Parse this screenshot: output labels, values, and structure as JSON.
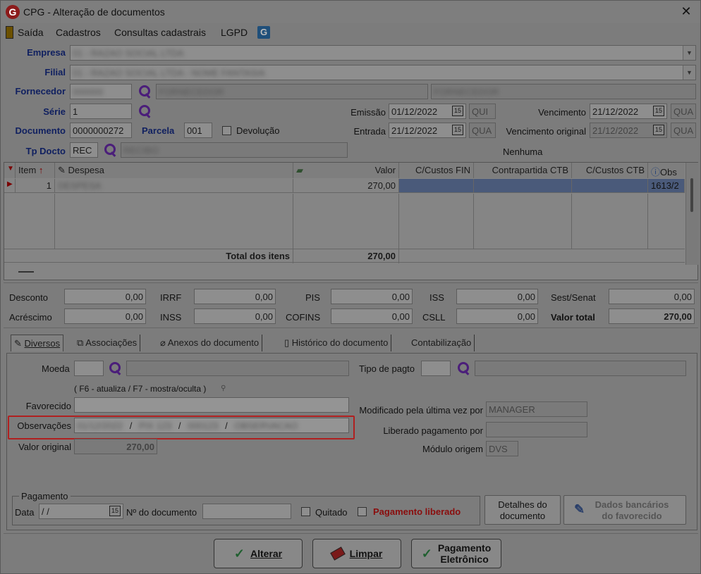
{
  "window": {
    "title": "CPG - Alteração de documentos",
    "logo_letter": "G",
    "close": "✕"
  },
  "menu": {
    "items": [
      "Saída",
      "Cadastros",
      "Consultas cadastrais",
      "LGPD"
    ]
  },
  "header": {
    "empresa_label": "Empresa",
    "empresa_value": "01 - RAZAO SOCIAL LTDA",
    "filial_label": "Filial",
    "filial_value": "01 - RAZAO SOCIAL LTDA - NOME FANTASIA",
    "fornecedor_label": "Fornecedor",
    "fornecedor_code": "000000",
    "fornecedor_name": "FORNECEDOR",
    "fornecedor_extra": "FORNECEDOR",
    "serie_label": "Série",
    "serie_value": "1",
    "documento_label": "Documento",
    "documento_value": "0000000272",
    "parcela_label": "Parcela",
    "parcela_value": "001",
    "devolucao_label": "Devolução",
    "tpdocto_label": "Tp Docto",
    "tpdocto_value": "REC",
    "tpdocto_desc": "RECIBO",
    "emissao_label": "Emissão",
    "emissao_value": "01/12/2022",
    "emissao_day": "QUI",
    "entrada_label": "Entrada",
    "entrada_value": "21/12/2022",
    "entrada_day": "QUA",
    "vencimento_label": "Vencimento",
    "vencimento_value": "21/12/2022",
    "vencimento_day": "QUA",
    "venc_orig_label": "Vencimento original",
    "venc_orig_value": "21/12/2022",
    "venc_orig_day": "QUA",
    "nenhuma": "Nenhuma",
    "cal_icon": "15"
  },
  "grid": {
    "columns": [
      "Item",
      "Despesa",
      "Valor",
      "C/Custos FIN",
      "Contrapartida CTB",
      "C/Custos CTB",
      "Obs"
    ],
    "rows": [
      {
        "item": "1",
        "despesa": "DESPESA",
        "valor": "270,00",
        "obs": "1613/2"
      }
    ],
    "total_label": "Total dos itens",
    "total_value": "270,00"
  },
  "totals": {
    "desconto_label": "Desconto",
    "desconto": "0,00",
    "irrf_label": "IRRF",
    "irrf": "0,00",
    "pis_label": "PIS",
    "pis": "0,00",
    "iss_label": "ISS",
    "iss": "0,00",
    "sest_label": "Sest/Senat",
    "sest": "0,00",
    "acrescimo_label": "Acréscimo",
    "acrescimo": "0,00",
    "inss_label": "INSS",
    "inss": "0,00",
    "cofins_label": "COFINS",
    "cofins": "0,00",
    "csll_label": "CSLL",
    "csll": "0,00",
    "valor_total_label": "Valor total",
    "valor_total": "270,00"
  },
  "tabs": [
    "Diversos",
    "Associações",
    "Anexos do documento",
    "Histórico do documento",
    "Contabilização"
  ],
  "diversos": {
    "moeda_label": "Moeda",
    "tipo_pagto_label": "Tipo de pagto",
    "hint": "( F6 - atualiza / F7 - mostra/oculta )",
    "favorecido_label": "Favorecido",
    "observacoes_label": "Observações",
    "obs_parts": [
      "01/12/2022",
      "PIX 123",
      "000123",
      "OBSERVACAO"
    ],
    "valor_original_label": "Valor original",
    "valor_original": "270,00",
    "modificado_label": "Modificado pela última vez por",
    "modificado_value": "MANAGER",
    "liberado_label": "Liberado pagamento por",
    "modulo_label": "Módulo origem",
    "modulo_value": "DVS"
  },
  "pagamento": {
    "group_label": "Pagamento",
    "data_label": "Data",
    "data_value": "/ /",
    "ndoc_label": "Nº do documento",
    "quitado_label": "Quitado",
    "liberado_label": "Pagamento liberado",
    "detalhes_button": [
      "Detalhes do",
      "documento"
    ],
    "dados_button": [
      "Dados bancários",
      "do favorecido"
    ]
  },
  "buttons": {
    "alterar": "Alterar",
    "limpar": "Limpar",
    "pagamento": [
      "Pagamento",
      "Eletrônico"
    ]
  },
  "colors": {
    "highlight": "#b02020",
    "pagamento_liberado": "#8a0d0d",
    "label_blue": "#102060"
  }
}
